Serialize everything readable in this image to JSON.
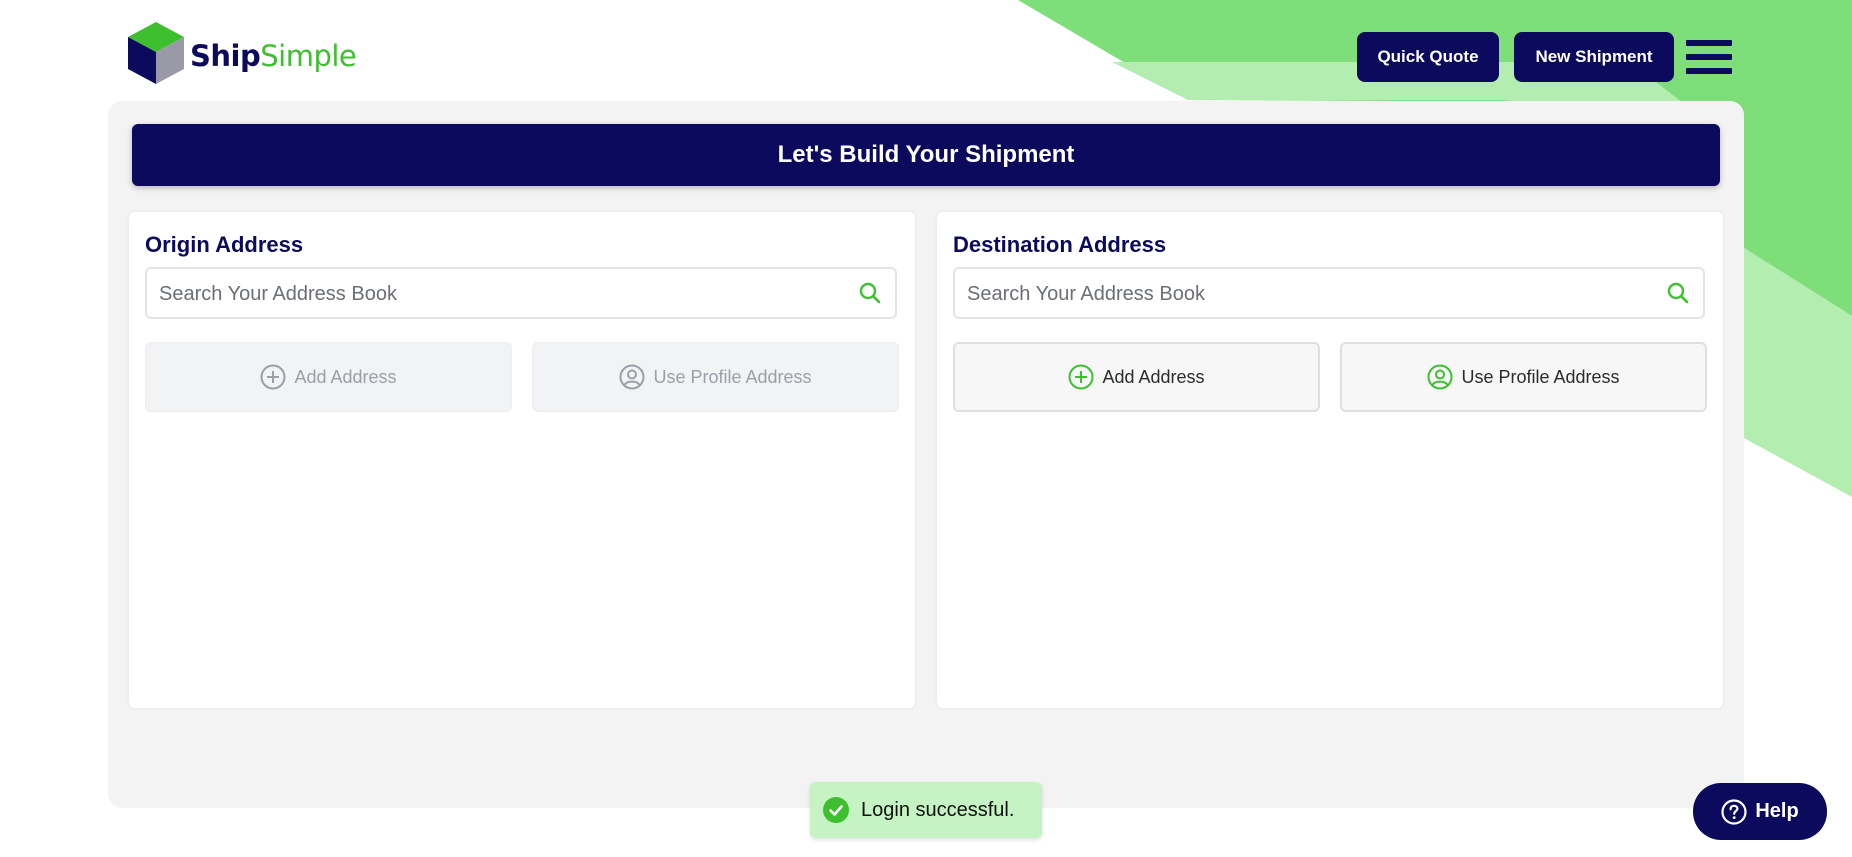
{
  "brand": {
    "name_part1": "Ship",
    "name_part2": "Simple"
  },
  "header": {
    "quick_quote_label": "Quick Quote",
    "new_shipment_label": "New Shipment",
    "menu_icon": "hamburger-icon"
  },
  "main": {
    "title": "Let's Build Your Shipment",
    "origin": {
      "heading": "Origin Address",
      "search_placeholder": "Search Your Address Book",
      "add_address_label": "Add Address",
      "profile_address_label": "Use Profile Address",
      "buttons_state": "disabled"
    },
    "destination": {
      "heading": "Destination Address",
      "search_placeholder": "Search Your Address Book",
      "add_address_label": "Add Address",
      "profile_address_label": "Use Profile Address",
      "buttons_state": "enabled"
    }
  },
  "toast": {
    "message": "Login successful.",
    "icon": "check-circle-icon"
  },
  "help": {
    "label": "Help",
    "icon": "question-circle-icon"
  },
  "colors": {
    "navy": "#0c0a5c",
    "green": "#3dbf2f",
    "panel_bg": "#f3f3f4",
    "toast_bg": "#c5f3c4"
  }
}
